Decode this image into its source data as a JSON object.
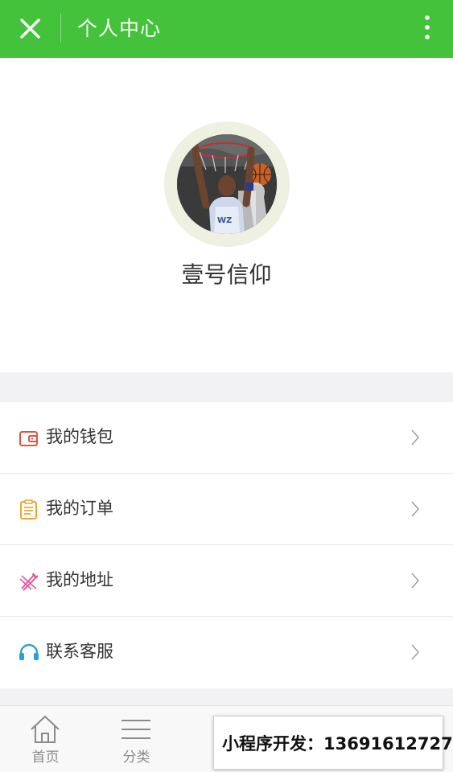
{
  "header": {
    "title": "个人中心",
    "close_icon": "close-icon",
    "more_icon": "more-vertical-icon",
    "background": "#45c23b"
  },
  "profile": {
    "avatar": "basketball-player-avatar",
    "username": "壹号信仰"
  },
  "menu": {
    "items": [
      {
        "label": "我的钱包",
        "icon": "wallet-icon",
        "color": "#e0533b"
      },
      {
        "label": "我的订单",
        "icon": "order-list-icon",
        "color": "#f0a32f"
      },
      {
        "label": "我的地址",
        "icon": "address-icon",
        "color": "#e55a9c"
      },
      {
        "label": "联系客服",
        "icon": "headset-icon",
        "color": "#2a9fd8"
      }
    ],
    "chevron": "chevron-right-icon"
  },
  "tabbar": {
    "tabs": [
      {
        "label": "首页",
        "icon": "home-icon"
      },
      {
        "label": "分类",
        "icon": "menu-lines-icon"
      }
    ]
  },
  "watermark": {
    "text": "小程序开发：13691612727"
  }
}
